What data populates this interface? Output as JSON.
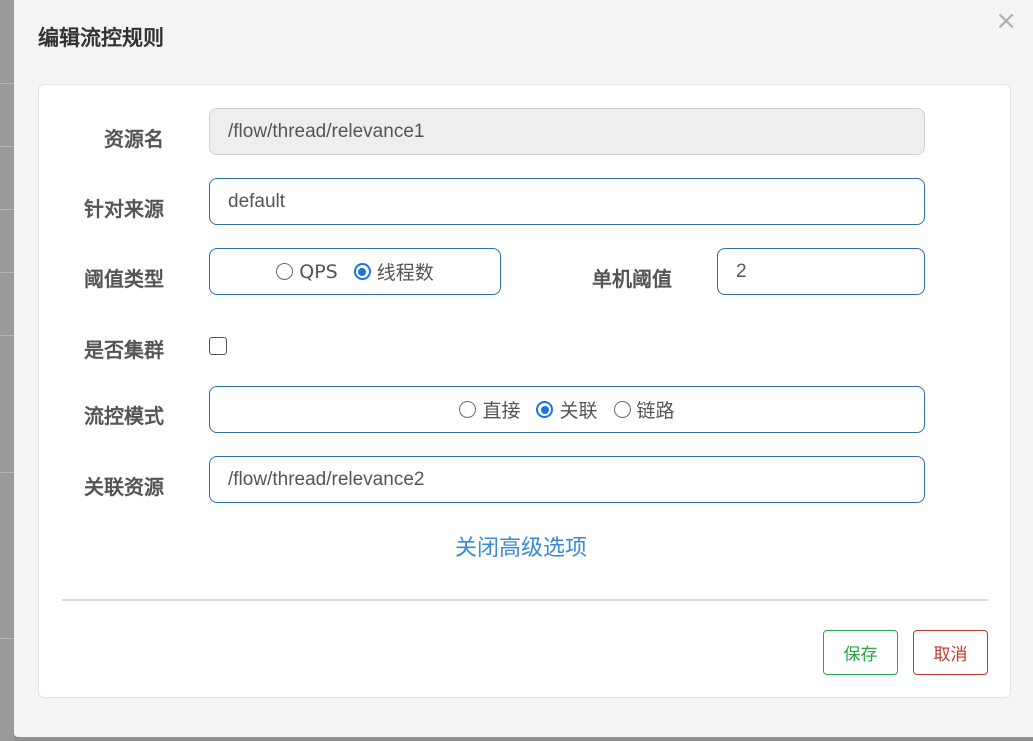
{
  "dialog": {
    "title": "编辑流控规则",
    "close_label": "×"
  },
  "form": {
    "resource_name": {
      "label": "资源名",
      "value": "/flow/thread/relevance1"
    },
    "limit_app": {
      "label": "针对来源",
      "value": "default"
    },
    "grade": {
      "label": "阈值类型",
      "options": [
        {
          "label": "QPS",
          "checked": false
        },
        {
          "label": "线程数",
          "checked": true
        }
      ]
    },
    "count": {
      "label": "单机阈值",
      "value": "2"
    },
    "cluster": {
      "label": "是否集群",
      "checked": false
    },
    "strategy": {
      "label": "流控模式",
      "options": [
        {
          "label": "直接",
          "checked": false
        },
        {
          "label": "关联",
          "checked": true
        },
        {
          "label": "链路",
          "checked": false
        }
      ]
    },
    "ref_resource": {
      "label": "关联资源",
      "value": "/flow/thread/relevance2"
    },
    "advanced_toggle": "关闭高级选项"
  },
  "footer": {
    "save_label": "保存",
    "cancel_label": "取消"
  },
  "colors": {
    "input_border": "#2f6ea8",
    "radio_checked": "#1a73e8",
    "link": "#3a8ad6",
    "save": "#28a745",
    "cancel": "#c0392b"
  }
}
